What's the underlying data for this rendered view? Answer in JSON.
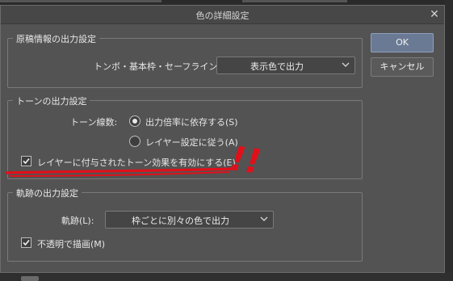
{
  "dialog": {
    "title": "色の詳細設定",
    "close_glyph": "✕"
  },
  "buttons": {
    "ok": "OK",
    "cancel": "キャンセル"
  },
  "manuscript_output": {
    "legend": "原稿情報の出力設定",
    "crop_label": "トンボ・基本枠・セーフライン(T):",
    "crop_value": "表示色で出力"
  },
  "tone_output": {
    "legend": "トーンの出力設定",
    "lines_label": "トーン線数:",
    "radio_1": "出力倍率に依存する(S)",
    "radio_1_selected": true,
    "radio_2": "レイヤー設定に従う(A)",
    "radio_2_selected": false,
    "enable_effect": "レイヤーに付与されたトーン効果を有効にする(E)",
    "enable_effect_checked": true
  },
  "trace_output": {
    "legend": "軌跡の出力設定",
    "trace_label": "軌跡(L):",
    "trace_value": "枠ごとに別々の色で出力",
    "opaque": "不透明で描画(M)",
    "opaque_checked": true
  },
  "annotation": {
    "marks": "!!",
    "color": "#e0101a"
  },
  "colors": {
    "dialog_bg": "#535353",
    "ok_button": "#6b7a94"
  }
}
